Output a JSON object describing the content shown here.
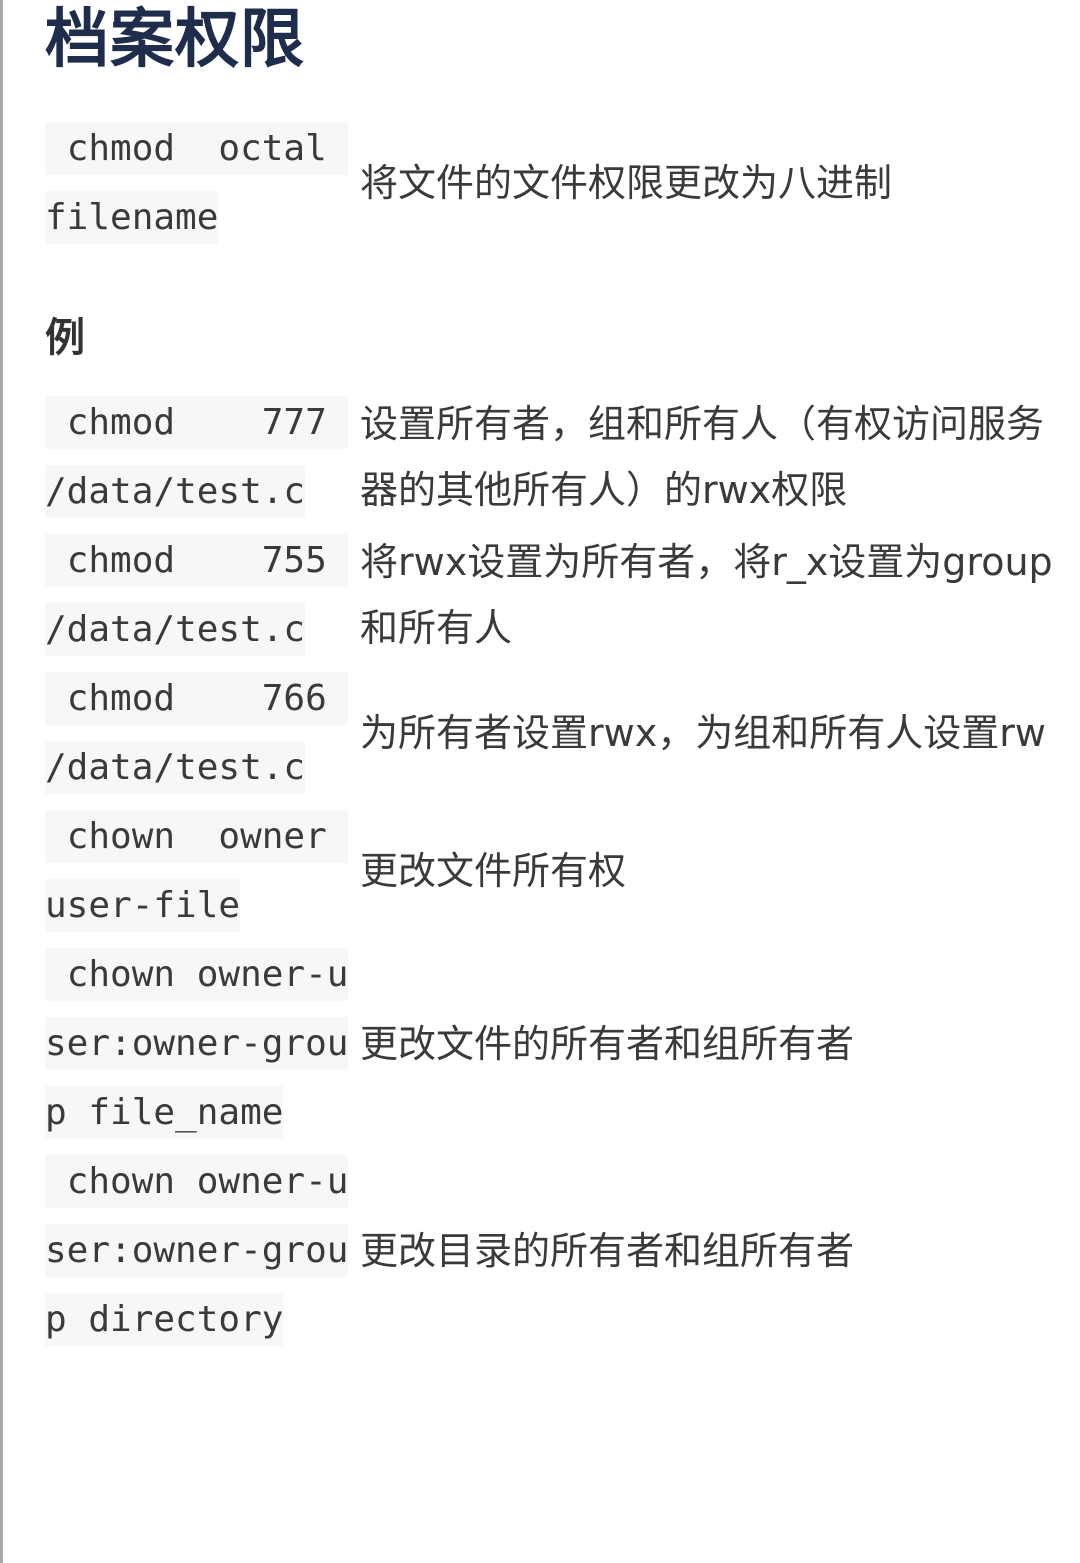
{
  "title": "档案权限",
  "intro": {
    "command": " chmod  octal filename",
    "description": "将文件的文件权限更改为八进制"
  },
  "example_heading": "例",
  "examples": [
    {
      "command": " chmod    777 /data/test.c",
      "description": "设置所有者，组和所有人（有权访问服务器的其他所有人）的rwx权限"
    },
    {
      "command": " chmod    755 /data/test.c",
      "description": "将rwx设置为所有者，将r_x设置为group和所有人"
    },
    {
      "command": " chmod    766 /data/test.c",
      "description": "为所有者设置rwx，为组和所有人设置rw"
    },
    {
      "command": " chown  owner user-file",
      "description": "更改文件所有权"
    },
    {
      "command": " chown owner-user:owner-group file_name",
      "description": "更改文件的所有者和组所有者"
    },
    {
      "command": " chown owner-user:owner-group directory",
      "description": "更改目录的所有者和组所有者"
    }
  ]
}
